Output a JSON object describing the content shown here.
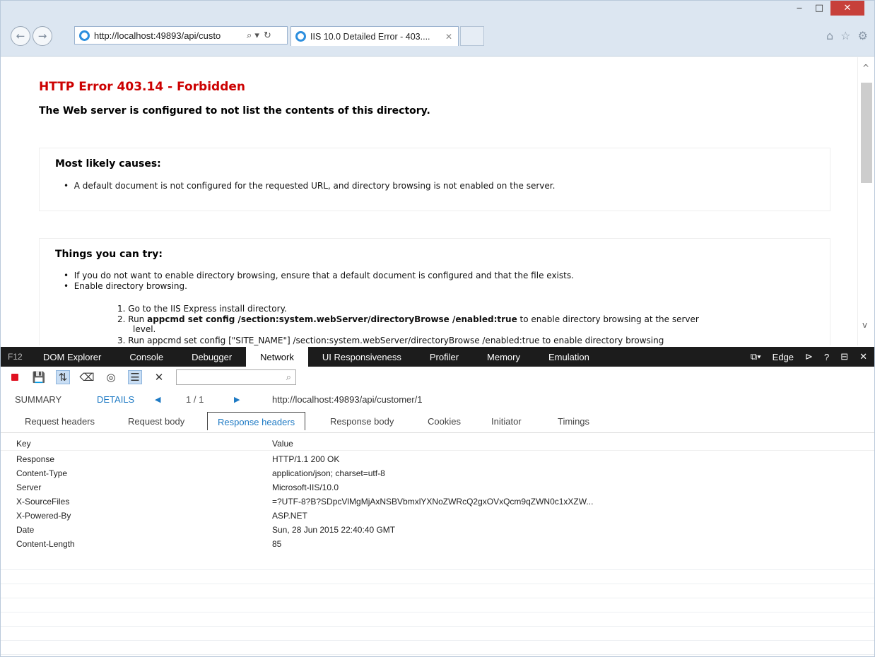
{
  "window": {
    "minimize": "‒",
    "maximize": "□",
    "close": "✕"
  },
  "navigation": {
    "back": "←",
    "forward": "→",
    "address": "http://localhost:49893/api/custo",
    "search_glyph": "⌕ ▾",
    "refresh_glyph": "↻"
  },
  "tab": {
    "title": "IIS 10.0 Detailed Error - 403....",
    "close": "✕"
  },
  "toolbar_icons": [
    "home-icon",
    "favorites-star-icon",
    "settings-gear-icon"
  ],
  "page": {
    "error_title": "HTTP Error 403.14 - Forbidden",
    "error_subtitle": "The Web server is configured to not list the contents of this directory.",
    "causes_heading": "Most likely causes:",
    "causes": [
      "A default document is not configured for the requested URL, and directory browsing is not enabled on the server."
    ],
    "try_heading": "Things you can try:",
    "try_items": [
      "If you do not want to enable directory browsing, ensure that a default document is configured and that the file exists.",
      "Enable directory browsing."
    ],
    "steps": {
      "step1": "1.  Go to the IIS Express install directory.",
      "step2_prefix": "2.  Run ",
      "step2_cmd": "appcmd set config /section:system.webServer/directoryBrowse /enabled:true",
      "step2_suffix": " to enable directory browsing at the server",
      "step2_wrap": "level.",
      "step3_partial": "3.  Run appcmd set config [\"SITE_NAME\"] /section:system.webServer/directoryBrowse /enabled:true to enable directory browsing"
    }
  },
  "devtools": {
    "label": "F12",
    "tabs": [
      "DOM Explorer",
      "Console",
      "Debugger",
      "Network",
      "UI Responsiveness",
      "Profiler",
      "Memory",
      "Emulation"
    ],
    "active_tab": "Network",
    "mode": "Edge",
    "right_controls": {
      "emulation_glyph": "⧉▾",
      "console_glyph": "⊳",
      "help": "?",
      "undock": "⊟",
      "close": "✕"
    },
    "search_placeholder": "",
    "nav": {
      "summary": "SUMMARY",
      "details": "DETAILS",
      "prev": "◀",
      "count": "1 / 1",
      "next": "▶",
      "url": "http://localhost:49893/api/customer/1"
    },
    "subtabs": [
      "Request headers",
      "Request body",
      "Response headers",
      "Response body",
      "Cookies",
      "Initiator",
      "Timings"
    ],
    "active_subtab": "Response headers",
    "headers_columns": {
      "key": "Key",
      "value": "Value"
    },
    "headers": [
      {
        "key": "Response",
        "value": "HTTP/1.1 200 OK"
      },
      {
        "key": "Content-Type",
        "value": "application/json; charset=utf-8"
      },
      {
        "key": "Server",
        "value": "Microsoft-IIS/10.0"
      },
      {
        "key": "X-SourceFiles",
        "value": "=?UTF-8?B?SDpcVlMgMjAxNSBVbmxlYXNoZWRcQ2gxOVxQcm9qZWN0c1xXZW..."
      },
      {
        "key": "X-Powered-By",
        "value": "ASP.NET"
      },
      {
        "key": "Date",
        "value": "Sun, 28 Jun 2015 22:40:40 GMT"
      },
      {
        "key": "Content-Length",
        "value": "85"
      }
    ]
  }
}
